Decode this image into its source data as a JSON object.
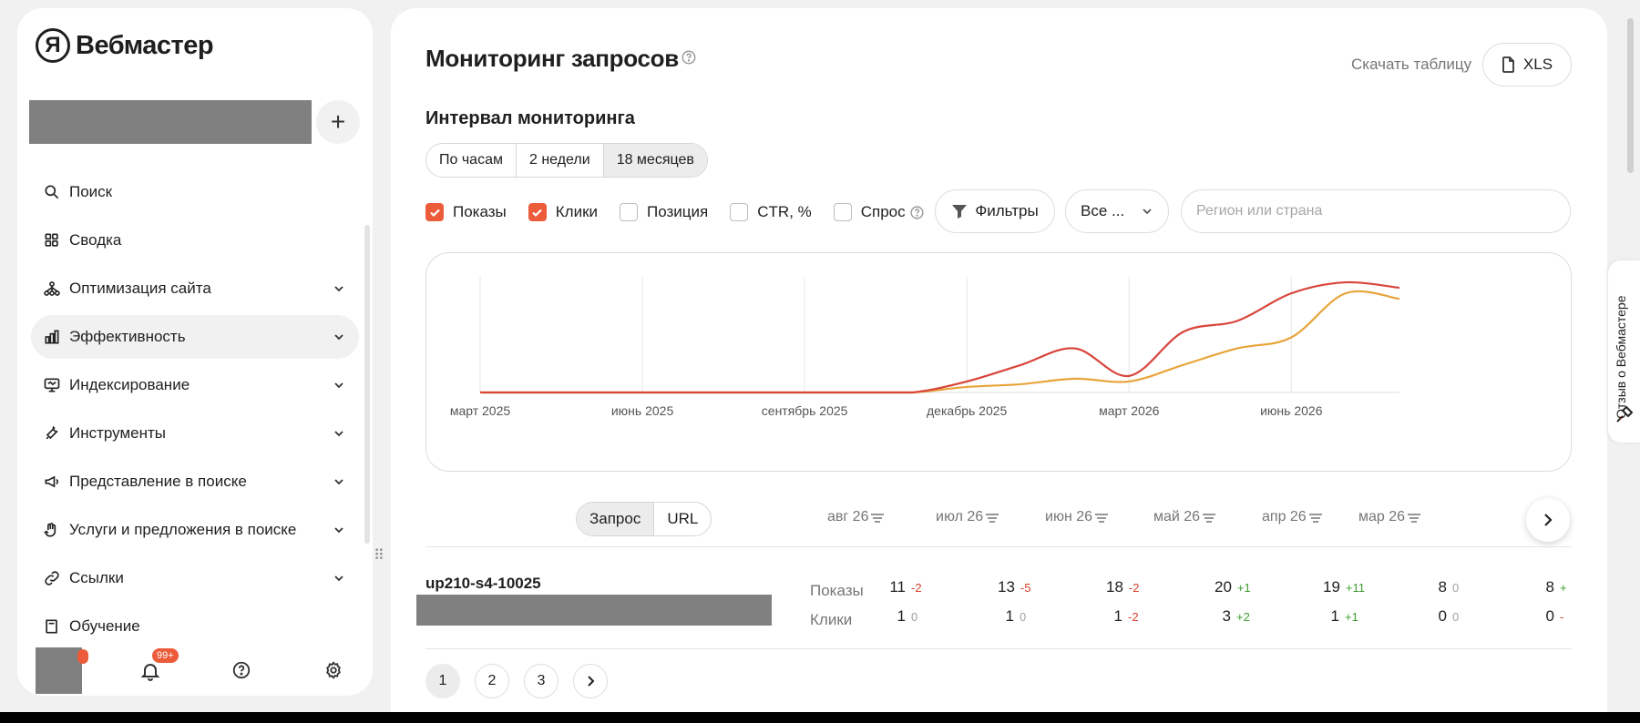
{
  "brand": {
    "logo_letter": "Я",
    "name": "Вебмастер"
  },
  "sidebar": {
    "add_label": "+",
    "items": [
      {
        "label": "Поиск",
        "icon": "search-icon",
        "chevron": false
      },
      {
        "label": "Сводка",
        "icon": "grid-icon",
        "chevron": false
      },
      {
        "label": "Оптимизация сайта",
        "icon": "structure-icon",
        "chevron": true
      },
      {
        "label": "Эффективность",
        "icon": "bar-chart-icon",
        "chevron": true,
        "active": true
      },
      {
        "label": "Индексирование",
        "icon": "monitor-icon",
        "chevron": true
      },
      {
        "label": "Инструменты",
        "icon": "wrench-icon",
        "chevron": true
      },
      {
        "label": "Представление в поиске",
        "icon": "megaphone-icon",
        "chevron": true
      },
      {
        "label": "Услуги и предложения в поиске",
        "icon": "hand-icon",
        "chevron": true
      },
      {
        "label": "Ссылки",
        "icon": "link-icon",
        "chevron": true
      },
      {
        "label": "Обучение",
        "icon": "book-icon",
        "chevron": false
      }
    ],
    "notifications_badge": "99+"
  },
  "header": {
    "title": "Мониторинг запросов",
    "download_label": "Скачать таблицу",
    "xls_label": "XLS"
  },
  "interval": {
    "label": "Интервал мониторинга",
    "options": [
      "По часам",
      "2 недели",
      "18 месяцев"
    ],
    "selected": "18 месяцев"
  },
  "metrics": [
    {
      "label": "Показы",
      "checked": true,
      "help": false
    },
    {
      "label": "Клики",
      "checked": true,
      "help": false
    },
    {
      "label": "Позиция",
      "checked": false,
      "help": false
    },
    {
      "label": "CTR, %",
      "checked": false,
      "help": false
    },
    {
      "label": "Спрос",
      "checked": false,
      "help": true
    }
  ],
  "filters": {
    "filters_label": "Фильтры",
    "all_select_value": "Все ...",
    "region_placeholder": "Регион или страна"
  },
  "chart_data": {
    "type": "line",
    "x_ticks": [
      "март 2025",
      "июнь 2025",
      "сентябрь 2025",
      "декабрь 2025",
      "март 2026",
      "июнь 2026"
    ],
    "x": [
      "2025-03",
      "2025-04",
      "2025-05",
      "2025-06",
      "2025-07",
      "2025-08",
      "2025-09",
      "2025-10",
      "2025-11",
      "2025-12",
      "2026-01",
      "2026-02",
      "2026-03",
      "2026-04",
      "2026-05",
      "2026-06",
      "2026-07",
      "2026-08"
    ],
    "series": [
      {
        "name": "Показы",
        "color": "#d9443a",
        "values": [
          0,
          0,
          0,
          0,
          0,
          0,
          0,
          0,
          0,
          2,
          5,
          8,
          3,
          11,
          13,
          18,
          20,
          19
        ]
      },
      {
        "name": "Клики",
        "color": "#e8a43a",
        "values": [
          0,
          0,
          0,
          0,
          0,
          0,
          0,
          0,
          0,
          1,
          1.5,
          2.5,
          2,
          5,
          8,
          10,
          18,
          17
        ]
      }
    ],
    "y_min": 0,
    "y_max": 21,
    "grid_vertical": true,
    "legend": "none"
  },
  "table": {
    "tabs": [
      "Запрос",
      "URL"
    ],
    "selected_tab": "Запрос",
    "months": [
      "авг 26",
      "июл 26",
      "июн 26",
      "май 26",
      "апр 26",
      "мар 26"
    ],
    "rows": [
      {
        "query": "up210-s4-10025",
        "metrics": [
          {
            "label": "Показы",
            "cells": [
              {
                "v": "11",
                "d": "-2"
              },
              {
                "v": "13",
                "d": "-5"
              },
              {
                "v": "18",
                "d": "-2"
              },
              {
                "v": "20",
                "d": "+1"
              },
              {
                "v": "19",
                "d": "+11"
              },
              {
                "v": "8",
                "d": "0"
              },
              {
                "v": "8",
                "d": "+"
              }
            ]
          },
          {
            "label": "Клики",
            "cells": [
              {
                "v": "1",
                "d": "0"
              },
              {
                "v": "1",
                "d": "0"
              },
              {
                "v": "1",
                "d": "-2"
              },
              {
                "v": "3",
                "d": "+2"
              },
              {
                "v": "1",
                "d": "+1"
              },
              {
                "v": "0",
                "d": "0"
              },
              {
                "v": "0",
                "d": "-"
              }
            ]
          }
        ]
      }
    ]
  },
  "pagination": {
    "pages": [
      "1",
      "2",
      "3"
    ],
    "current": "1"
  },
  "feedback_label": "Отзыв о Вебмастере"
}
